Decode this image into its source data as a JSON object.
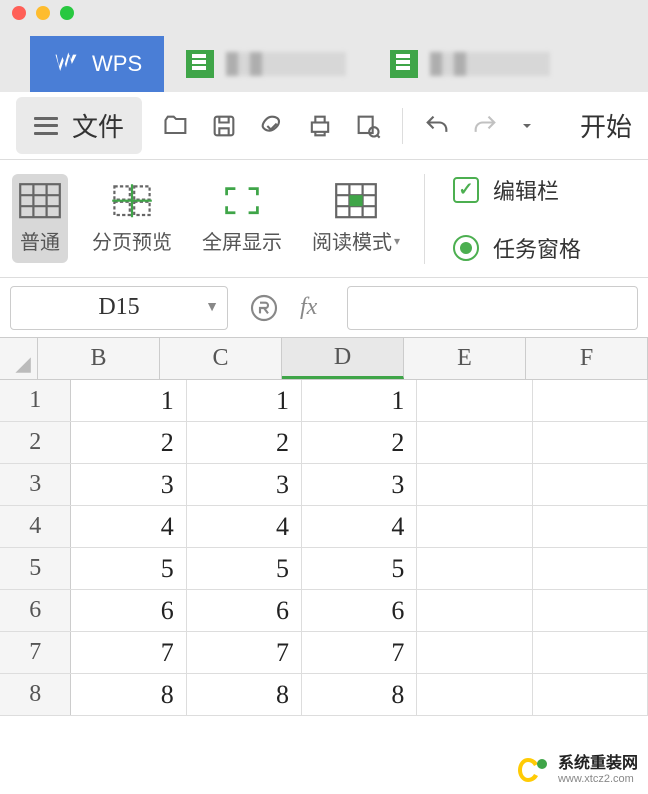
{
  "app": {
    "name": "WPS"
  },
  "toolbar": {
    "file": "文件",
    "start": "开始"
  },
  "ribbon": {
    "views": {
      "normal": "普通",
      "page_preview": "分页预览",
      "fullscreen": "全屏显示",
      "reading": "阅读模式"
    },
    "formula_bar": "编辑栏",
    "task_pane": "任务窗格"
  },
  "formula": {
    "name_box": "D15",
    "fx": "fx"
  },
  "sheet": {
    "cols": [
      "B",
      "C",
      "D",
      "E",
      "F"
    ],
    "selected_col": "D",
    "rows": [
      {
        "n": "1",
        "cells": [
          "1",
          "1",
          "1",
          "",
          ""
        ]
      },
      {
        "n": "2",
        "cells": [
          "2",
          "2",
          "2",
          "",
          ""
        ]
      },
      {
        "n": "3",
        "cells": [
          "3",
          "3",
          "3",
          "",
          ""
        ]
      },
      {
        "n": "4",
        "cells": [
          "4",
          "4",
          "4",
          "",
          ""
        ]
      },
      {
        "n": "5",
        "cells": [
          "5",
          "5",
          "5",
          "",
          ""
        ]
      },
      {
        "n": "6",
        "cells": [
          "6",
          "6",
          "6",
          "",
          ""
        ]
      },
      {
        "n": "7",
        "cells": [
          "7",
          "7",
          "7",
          "",
          ""
        ]
      },
      {
        "n": "8",
        "cells": [
          "8",
          "8",
          "8",
          "",
          ""
        ]
      }
    ]
  },
  "watermark": {
    "text1": "系统重装网",
    "text2": "www.xtcz2.com"
  }
}
